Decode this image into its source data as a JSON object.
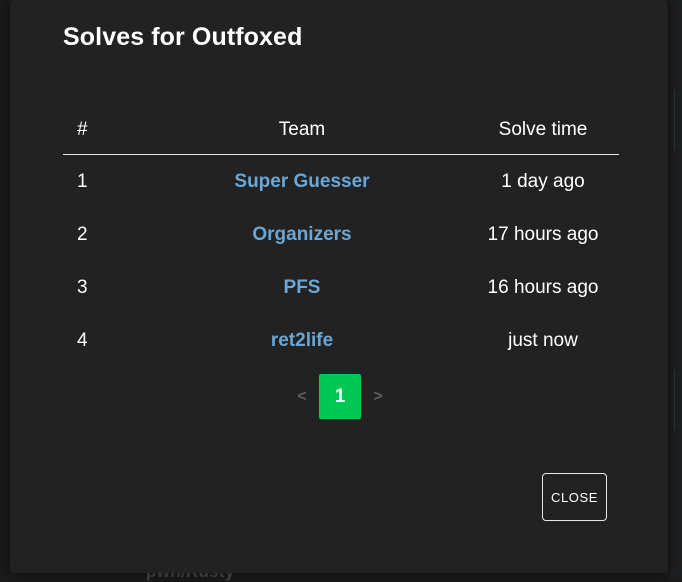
{
  "modal": {
    "title": "Solves for Outfoxed",
    "close_label": "CLOSE"
  },
  "table": {
    "headers": {
      "num": "#",
      "team": "Team",
      "time": "Solve time"
    },
    "rows": [
      {
        "num": "1",
        "team": "Super Guesser",
        "time": "1 day ago"
      },
      {
        "num": "2",
        "team": "Organizers",
        "time": "17 hours ago"
      },
      {
        "num": "3",
        "team": "PFS",
        "time": "16 hours ago"
      },
      {
        "num": "4",
        "team": "ret2life",
        "time": "just now"
      }
    ]
  },
  "pagination": {
    "prev_label": "<",
    "current_page": "1",
    "next_label": ">"
  },
  "background": {
    "peek_text": "pwn/Rusty"
  },
  "colors": {
    "modal_bg": "#222222",
    "team_link": "#6aa6d6",
    "active_page": "#00c853"
  }
}
